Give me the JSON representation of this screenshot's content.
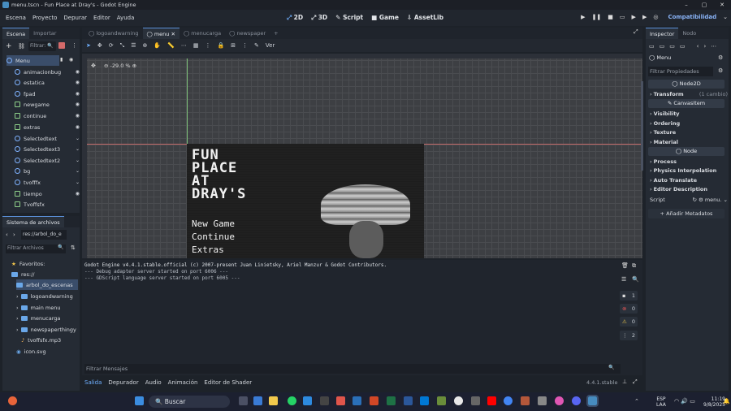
{
  "window": {
    "title": "menu.tscn - Fun Place at Dray's - Godot Engine",
    "min": "–",
    "max": "▢",
    "close": "✕"
  },
  "menubar": [
    "Escena",
    "Proyecto",
    "Depurar",
    "Editor",
    "Ayuda"
  ],
  "workspaces": {
    "w2d": "2D",
    "w3d": "3D",
    "script": "Script",
    "game": "Game",
    "assetlib": "AssetLib"
  },
  "renderer": "Compatibilidad",
  "scene_dock": {
    "tabs": [
      "Escena",
      "Importar"
    ],
    "filter_placeholder": "Filtrar: ",
    "nodes": [
      "Menu",
      "animacionbug",
      "estatica",
      "fpad",
      "newgame",
      "continue",
      "extras",
      "Selectedtext",
      "Selectedtext3",
      "Selectedtext2",
      "bg",
      "tvofffx",
      "tiempo",
      "Tvoffsfx"
    ]
  },
  "filesystem": {
    "title": "Sistema de archivos",
    "path": "res://arbol_do_e",
    "filter_placeholder": "Filtrar Archivos",
    "favorites": "Favoritos:",
    "items": [
      "res://",
      "arbol_do_escenas",
      "logoandwarning",
      "main menu",
      "menucarga",
      "newspaperthingy",
      "tvoffsfx.mp3",
      "icon.svg"
    ]
  },
  "editor_tabs": [
    "logoandwarning",
    "menu",
    "menucarga",
    "newspaper"
  ],
  "toolbar": {
    "view": "Ver",
    "zoom": "-29.0 %"
  },
  "game_preview": {
    "title_lines": [
      "FUN",
      "PLACE",
      "AT",
      "DRAY'S"
    ],
    "menu": [
      "New Game",
      "Continue",
      "Extras"
    ]
  },
  "output": {
    "lines": [
      "Godot Engine v4.4.1.stable.official (c) 2007-present Juan Linietsky, Ariel Manzur & Godot Contributors.",
      "--- Debug adapter server started on port 6006 ---",
      "--- GDScript language server started on port 6005 ---"
    ],
    "filter_placeholder": "Filtrar Mensajes",
    "counts": [
      "1",
      "0",
      "0",
      "2"
    ]
  },
  "bottom_tabs": [
    "Salida",
    "Depurador",
    "Audio",
    "Animación",
    "Editor de Shader"
  ],
  "version": "4.4.1.stable",
  "inspector": {
    "tabs": [
      "Inspector",
      "Nodo"
    ],
    "node": "Menu",
    "filter_placeholder": "Filtrar Propiedades",
    "sections": [
      {
        "hdr": "Node2D",
        "rows": [
          "Transform",
          "(1 cambio)"
        ]
      },
      {
        "hdr": "CanvasItem",
        "rows": [
          "Visibility",
          "Ordering",
          "Texture",
          "Material"
        ]
      },
      {
        "hdr": "Node",
        "rows": [
          "Process",
          "Physics Interpolation",
          "Auto Translate",
          "Editor Description"
        ]
      }
    ],
    "script_label": "Script",
    "script_value": "menu.",
    "add_meta": "Añadir Metadatos"
  },
  "taskbar": {
    "search": "Buscar",
    "lang": "ESP",
    "region": "LAA",
    "time": "11:19",
    "date": "9/8/2025"
  },
  "colors": {
    "accent": "#478cbf",
    "bg": "#1d2229",
    "panel": "#252b34"
  }
}
